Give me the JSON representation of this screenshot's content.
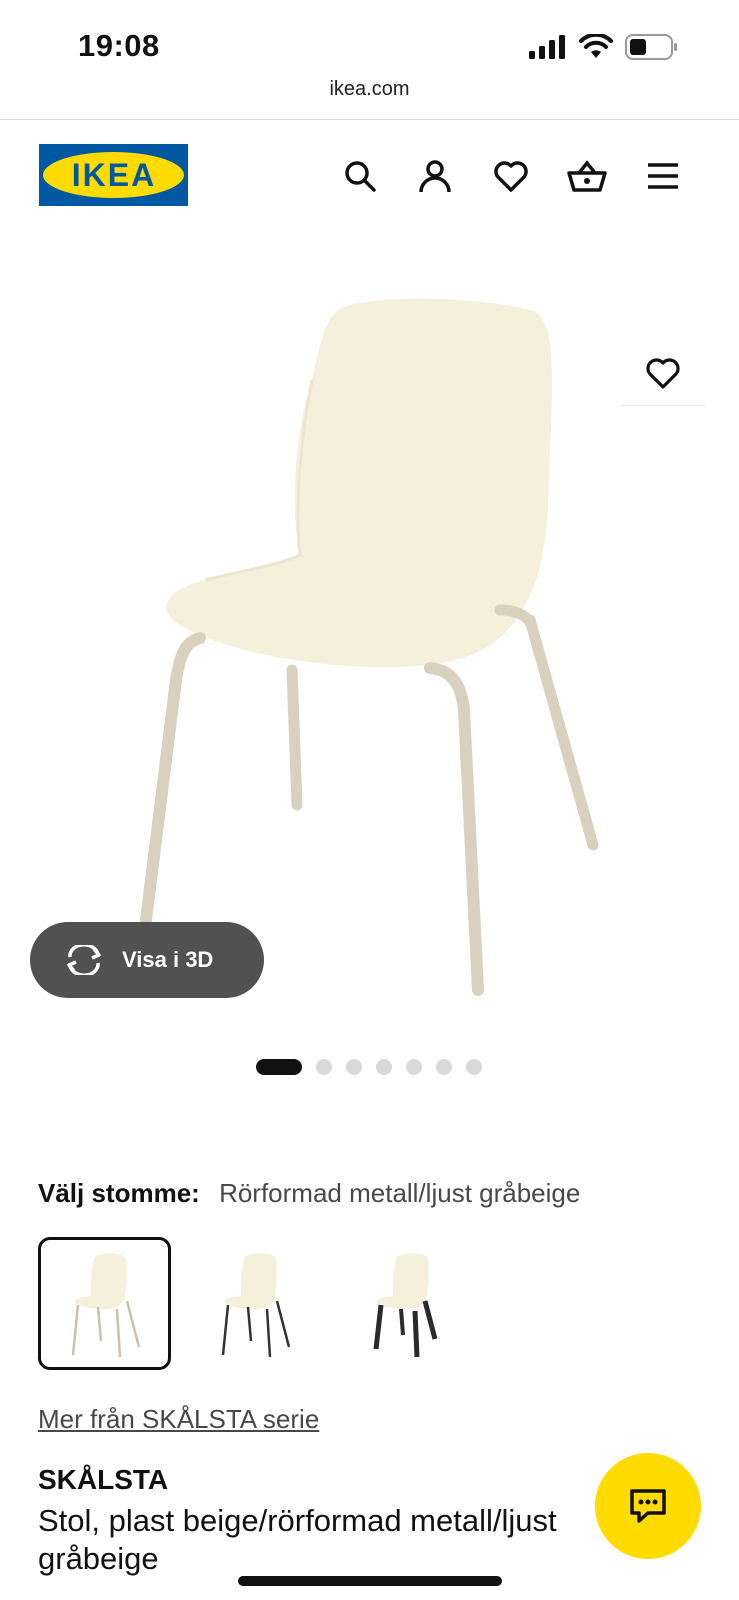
{
  "status_bar": {
    "time": "19:08"
  },
  "browser": {
    "url": "ikea.com"
  },
  "header": {
    "logo_text": "IKEA",
    "icons": [
      "search-icon",
      "account-icon",
      "heart-icon",
      "basket-icon",
      "menu-icon"
    ]
  },
  "gallery": {
    "view_3d_label": "Visa i 3D",
    "image_count": 7,
    "active_index": 0
  },
  "options": {
    "label": "Välj stomme:",
    "value": "Rörformad metall/ljust gråbeige",
    "swatches": [
      {
        "frame": "light-beige",
        "selected": true
      },
      {
        "frame": "black-metal",
        "selected": false
      },
      {
        "frame": "black-wood",
        "selected": false
      }
    ]
  },
  "series_link": "Mer från SKÅLSTA serie",
  "product": {
    "name": "SKÅLSTA",
    "description": "Stol, plast beige/rörformad metall/ljust gråbeige"
  },
  "colors": {
    "brand_blue": "#0058a3",
    "brand_yellow": "#ffdb00",
    "seat_color": "#f4f0dc",
    "leg_color": "#d8d1bd"
  }
}
